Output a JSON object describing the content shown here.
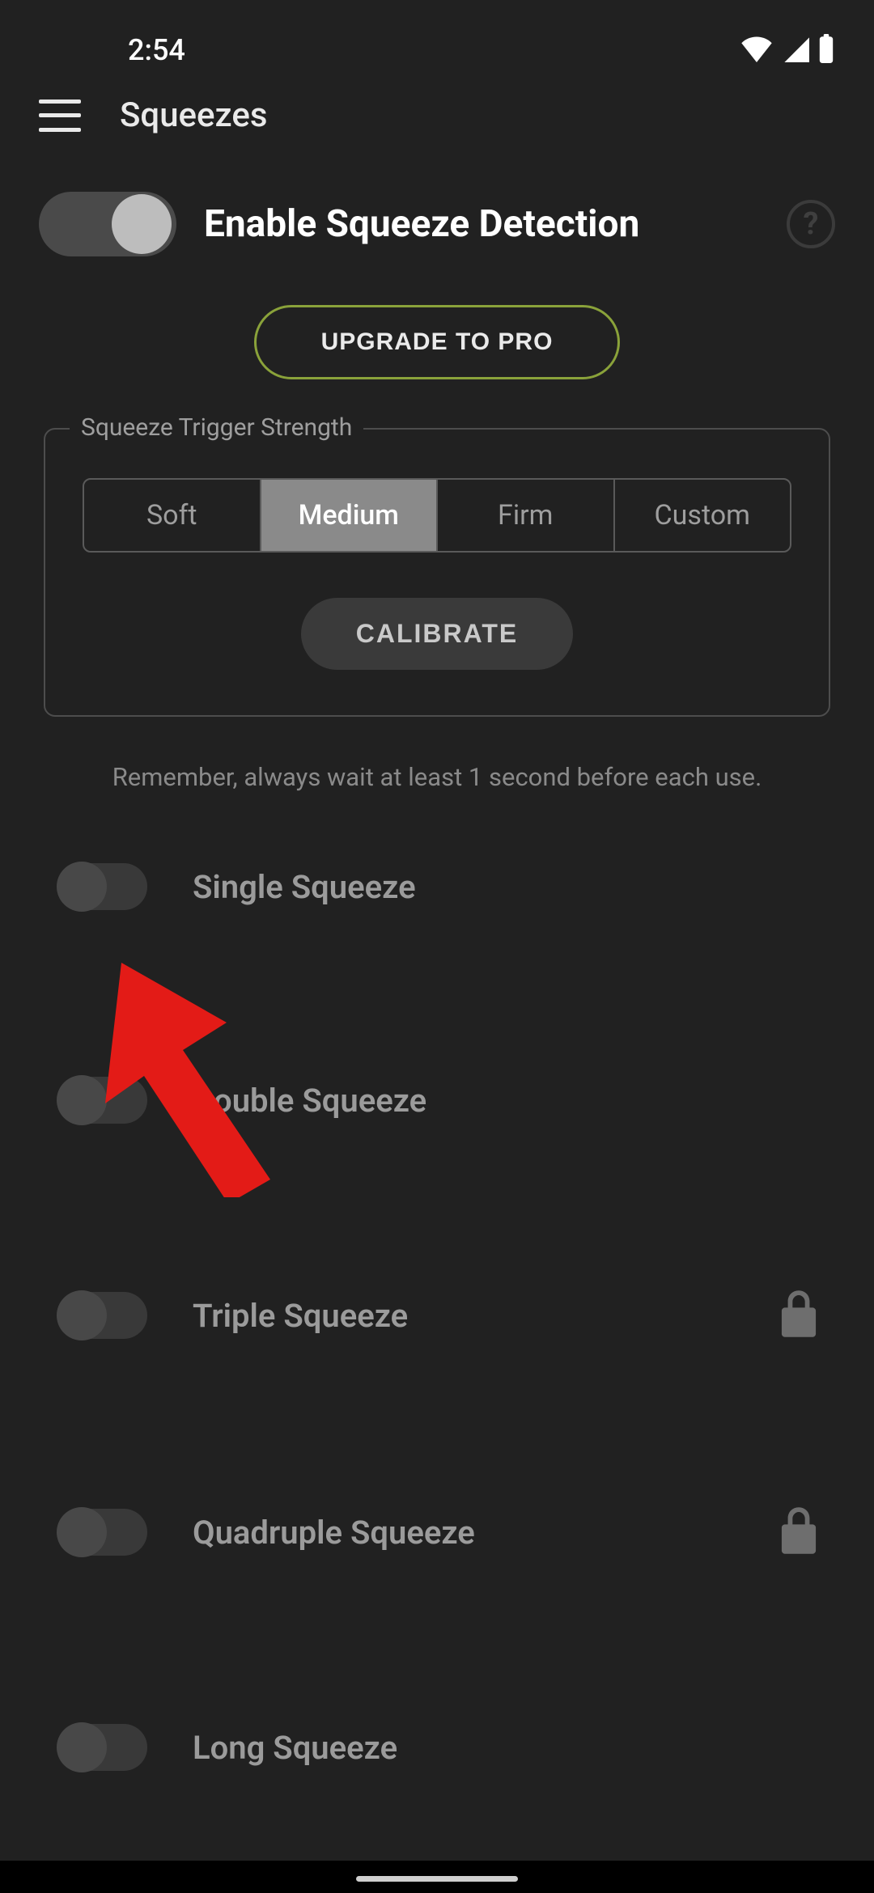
{
  "status": {
    "time": "2:54"
  },
  "appbar": {
    "title": "Squeezes"
  },
  "mainToggle": {
    "label": "Enable Squeeze Detection",
    "on": false
  },
  "upgrade": {
    "label": "UPGRADE TO PRO"
  },
  "strength": {
    "legend": "Squeeze Trigger Strength",
    "options": [
      "Soft",
      "Medium",
      "Firm",
      "Custom"
    ],
    "selected": "Medium",
    "calibrate": "CALIBRATE"
  },
  "hint": "Remember, always wait at least 1 second before each use.",
  "items": [
    {
      "label": "Single Squeeze",
      "on": false,
      "locked": false
    },
    {
      "label": "Double Squeeze",
      "on": false,
      "locked": false
    },
    {
      "label": "Triple Squeeze",
      "on": false,
      "locked": true
    },
    {
      "label": "Quadruple Squeeze",
      "on": false,
      "locked": true
    },
    {
      "label": "Long Squeeze",
      "on": false,
      "locked": false
    }
  ],
  "colors": {
    "accent": "#8aa23a",
    "arrow": "#e31b17"
  }
}
